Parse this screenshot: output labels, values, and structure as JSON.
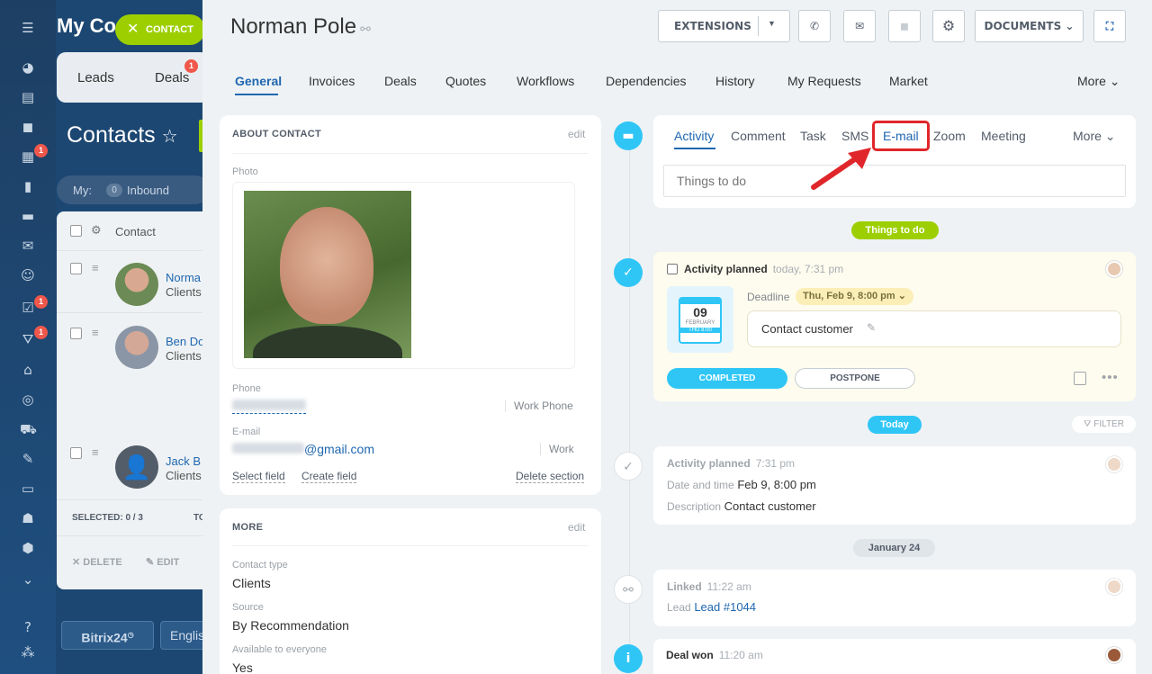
{
  "background": {
    "app_title": "My Co",
    "contact_button": "CONTACT",
    "tabs": [
      "Leads",
      "Deals"
    ],
    "deals_badge": "1",
    "contacts_title": "Contacts",
    "filter_my": "My:",
    "filter_count": "0",
    "filter_inbound": "Inbound",
    "list_header": "Contact",
    "rows": [
      {
        "name": "Norma",
        "sub": "Clients"
      },
      {
        "name": "Ben Do",
        "sub": "Clients"
      },
      {
        "name": "Jack B",
        "sub": "Clients"
      }
    ],
    "selected": "SELECTED: 0 / 3",
    "selected_tail": "TO",
    "delete_label": "DELETE",
    "edit_label": "EDIT",
    "bitrix_label": "Bitrix24",
    "lang_label": "Englis",
    "rail_badges": [
      "1",
      "1",
      "1"
    ]
  },
  "header": {
    "title": "Norman Pole",
    "extensions_label": "EXTENSIONS",
    "documents_label": "DOCUMENTS"
  },
  "tabs": [
    "General",
    "Invoices",
    "Deals",
    "Quotes",
    "Workflows",
    "Dependencies",
    "History",
    "My Requests",
    "Market"
  ],
  "tabs_more": "More",
  "about": {
    "heading": "ABOUT CONTACT",
    "edit": "edit",
    "photo_label": "Photo",
    "phone_label": "Phone",
    "phone_type": "Work Phone",
    "email_label": "E-mail",
    "email_domain": "@gmail.com",
    "email_type": "Work",
    "select_field": "Select field",
    "create_field": "Create field",
    "delete_section": "Delete section"
  },
  "more_card": {
    "heading": "MORE",
    "edit": "edit",
    "fields": [
      {
        "label": "Contact type",
        "value": "Clients"
      },
      {
        "label": "Source",
        "value": "By Recommendation"
      },
      {
        "label": "Available to everyone",
        "value": "Yes"
      }
    ]
  },
  "activity_tabs": [
    "Activity",
    "Comment",
    "Task",
    "SMS",
    "E-mail",
    "Zoom",
    "Meeting"
  ],
  "activity_more": "More",
  "todo_placeholder": "Things to do",
  "things_to_do_pill": "Things to do",
  "planned": {
    "title": "Activity planned",
    "time": "today, 7:31 pm",
    "deadline_label": "Deadline",
    "deadline_value": "Thu, Feb 9, 8:00 pm",
    "cal_day": "09",
    "cal_month": "FEBRUARY",
    "cal_time": "THU 8:00",
    "description": "Contact customer",
    "completed": "COMPLETED",
    "postpone": "POSTPONE"
  },
  "today_pill": "Today",
  "filter_label": "FILTER",
  "history_planned": {
    "title": "Activity planned",
    "time": "7:31 pm",
    "dt_label": "Date and time",
    "dt_value": "Feb 9, 8:00 pm",
    "desc_label": "Description",
    "desc_value": "Contact customer"
  },
  "jan_pill": "January 24",
  "linked": {
    "title": "Linked",
    "time": "11:22 am",
    "lead_label": "Lead",
    "lead_value": "Lead #1044"
  },
  "deal_won": {
    "title": "Deal won",
    "time": "11:20 am"
  },
  "colors": {
    "accent_blue": "#2067b0",
    "timeline_blue": "#2fc6f6",
    "green": "#9dcf00",
    "highlight_red": "#e0262a"
  }
}
